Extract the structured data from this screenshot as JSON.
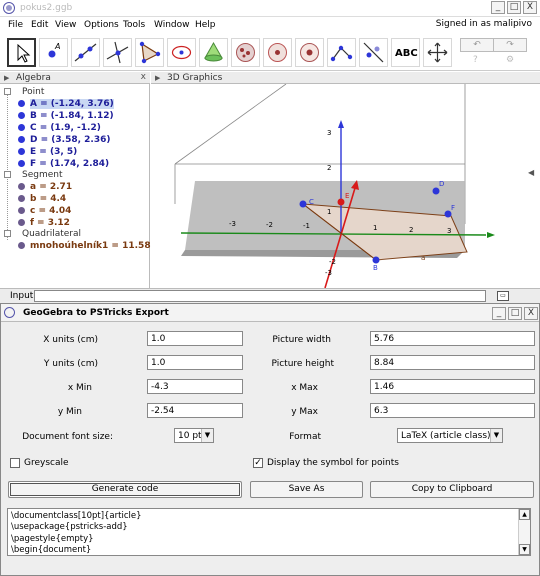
{
  "window": {
    "title": "pokus2.ggb",
    "minimize": "_",
    "maximize": "□",
    "close": "X"
  },
  "menu": [
    "File",
    "Edit",
    "View",
    "Options",
    "Tools",
    "Window",
    "Help"
  ],
  "signed_in": "Signed in as malipivo",
  "toolbar": {
    "text_tool_label": "ABC",
    "undo": "↶",
    "redo": "↷",
    "help": "?",
    "settings": "⚙"
  },
  "algebra": {
    "title": "Algebra",
    "categories": {
      "point": "Point",
      "segment": "Segment",
      "quadrilateral": "Quadrilateral"
    },
    "points": [
      "A = (-1.24, 3.76)",
      "B = (-1.84, 1.12)",
      "C = (1.9, -1.2)",
      "D = (3.58, 2.36)",
      "E = (3, 5)",
      "F = (1.74, 2.84)"
    ],
    "segments": [
      "a = 2.71",
      "b = 4.4",
      "c = 4.04",
      "f = 3.12"
    ],
    "quadrilaterals": [
      "mnohoúhelník1 = 11.58"
    ]
  },
  "graphics": {
    "title": "3D Graphics",
    "x_ticks": [
      "-3",
      "-2",
      "-1",
      "1",
      "2",
      "3"
    ],
    "y_ticks": [
      "-2",
      "-3"
    ],
    "z_ticks": [
      "1",
      "2",
      "3"
    ],
    "point_labels": [
      "B",
      "C",
      "D",
      "E",
      "F"
    ],
    "segment_label": "a"
  },
  "input": {
    "label": "Input:",
    "value": ""
  },
  "dialog": {
    "title": "GeoGebra to PSTricks Export",
    "x_units_label": "X units (cm)",
    "x_units": "1.0",
    "y_units_label": "Y units (cm)",
    "y_units": "1.0",
    "xmin_label": "x Min",
    "xmin": "-4.3",
    "ymin_label": "y Min",
    "ymin": "-2.54",
    "pic_width_label": "Picture width",
    "pic_width": "5.76",
    "pic_height_label": "Picture height",
    "pic_height": "8.84",
    "xmax_label": "x Max",
    "xmax": "1.46",
    "ymax_label": "y Max",
    "ymax": "6.3",
    "font_size_label": "Document font size:",
    "font_size": "10 pt",
    "format_label": "Format",
    "format": "LaTeX (article class)",
    "greyscale_label": "Greyscale",
    "greyscale_checked": false,
    "display_symbol_label": "Display the symbol for points",
    "display_symbol_checked": true,
    "generate_button": "Generate code",
    "save_button": "Save As",
    "copy_button": "Copy to Clipboard",
    "code_lines": [
      "\\documentclass[10pt]{article}",
      "\\usepackage{pstricks-add}",
      "\\pagestyle{empty}",
      "\\begin{document}"
    ]
  }
}
